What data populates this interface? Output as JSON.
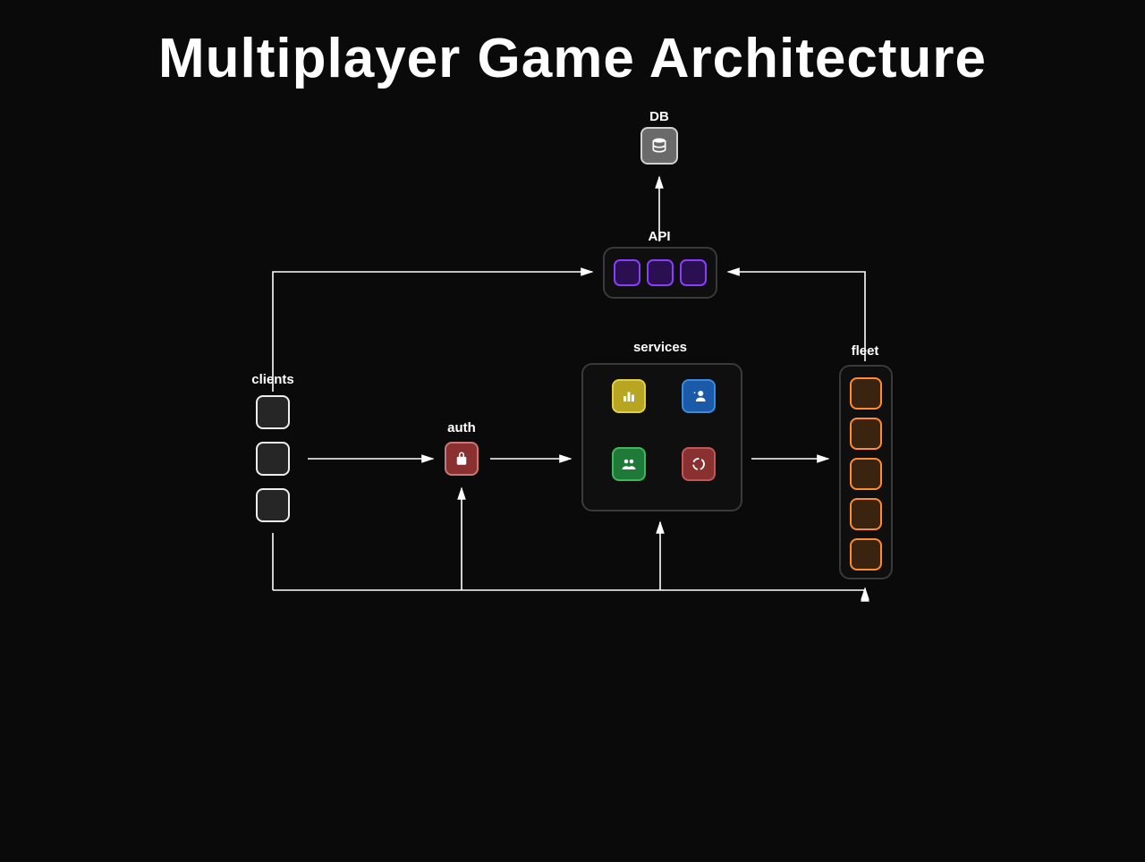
{
  "title": "Multiplayer Game Architecture",
  "nodes": {
    "db": {
      "label": "DB"
    },
    "api": {
      "label": "API",
      "instances": 3
    },
    "clients": {
      "label": "clients",
      "instances": 3
    },
    "auth": {
      "label": "auth"
    },
    "services": {
      "label": "services",
      "items": {
        "leaderboard": {
          "label": "leaderboard",
          "color": "yellow"
        },
        "friends": {
          "label": "friends",
          "color": "blue"
        },
        "matchmaking": {
          "label": "matchmaking",
          "color": "green"
        },
        "analytics": {
          "label": "analytics",
          "color": "red"
        }
      }
    },
    "fleet": {
      "label": "fleet",
      "instances": 5
    }
  },
  "edges": [
    {
      "from": "clients",
      "to": "auth"
    },
    {
      "from": "auth",
      "to": "services"
    },
    {
      "from": "services",
      "to": "fleet"
    },
    {
      "from": "clients",
      "to": "api"
    },
    {
      "from": "fleet",
      "to": "api"
    },
    {
      "from": "api",
      "to": "db"
    },
    {
      "from": "api",
      "to": "auth"
    },
    {
      "from": "api",
      "to": "services"
    },
    {
      "from": "api",
      "to": "fleet"
    }
  ]
}
